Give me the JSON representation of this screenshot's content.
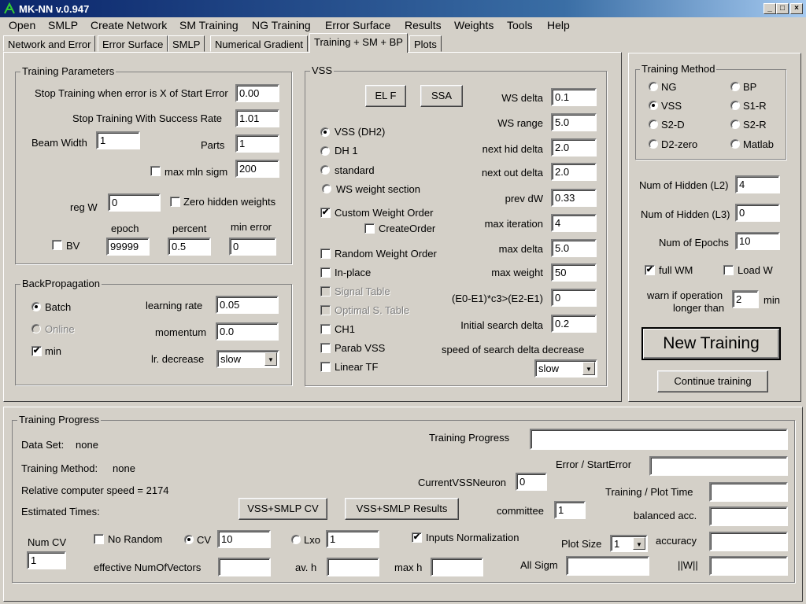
{
  "window": {
    "title": "MK-NN   v.0.947"
  },
  "menu": [
    "Open",
    "SMLP",
    "Create Network",
    "SM Training",
    "NG Training",
    "Error Surface",
    "Results",
    "Weights",
    "Tools",
    "Help"
  ],
  "tabs": [
    "Network and Error",
    "Error Surface",
    "SMLP",
    "Numerical Gradient",
    "Training + SM + BP",
    "Plots"
  ],
  "training_params": {
    "title": "Training Parameters",
    "stop_error_label": "Stop Training when error is X of Start Error",
    "stop_error_value": "0.00",
    "stop_success_label": "Stop Training With Success Rate",
    "stop_success_value": "1.01",
    "beam_width_label": "Beam Width",
    "beam_width_value": "1",
    "parts_label": "Parts",
    "parts_value": "1",
    "max_mln_label": "max mln sigm",
    "max_mln_value": "200",
    "reg_w_label": "reg W",
    "reg_w_value": "0",
    "zero_hidden_label": "Zero hidden weights",
    "epoch_label": "epoch",
    "percent_label": "percent",
    "min_error_label": "min error",
    "bv_label": "BV",
    "epoch_value": "99999",
    "percent_value": "0.5",
    "min_error_value": "0"
  },
  "backprop": {
    "title": "BackPropagation",
    "batch_label": "Batch",
    "online_label": "Online",
    "min_label": "min",
    "learning_rate_label": "learning rate",
    "learning_rate_value": "0.05",
    "momentum_label": "momentum",
    "momentum_value": "0.0",
    "lr_decrease_label": "lr. decrease",
    "lr_decrease_value": "slow"
  },
  "vss": {
    "title": "VSS",
    "elf_button": "EL F",
    "ssa_button": "SSA",
    "radio_vss_dh2": "VSS (DH2)",
    "radio_dh1": "DH 1",
    "radio_standard": "standard",
    "radio_ws_section": "WS weight section",
    "custom_weight_order": "Custom Weight Order",
    "create_order": "CreateOrder",
    "random_weight_order": "Random Weight Order",
    "in_place": "In-place",
    "signal_table": "Signal Table",
    "optimal_s_table": "Optimal S. Table",
    "ch1": "CH1",
    "parab_vss": "Parab VSS",
    "linear_tf": "Linear TF",
    "fields": [
      {
        "label": "WS delta",
        "value": "0.1"
      },
      {
        "label": "WS range",
        "value": "5.0"
      },
      {
        "label": "next hid delta",
        "value": "2.0"
      },
      {
        "label": "next out delta",
        "value": "2.0"
      },
      {
        "label": "prev dW",
        "value": "0.33"
      },
      {
        "label": "max iteration",
        "value": "4"
      },
      {
        "label": "max delta",
        "value": "5.0"
      },
      {
        "label": "max weight",
        "value": "50"
      },
      {
        "label": "(E0-E1)*c3>(E2-E1)",
        "value": "0"
      },
      {
        "label": "Initial search delta",
        "value": "0.2"
      }
    ],
    "speed_label": "speed of search delta decrease",
    "speed_value": "slow"
  },
  "training_method": {
    "title": "Training Method",
    "options": [
      "NG",
      "BP",
      "VSS",
      "S1-R",
      "S2-D",
      "S2-R",
      "D2-zero",
      "Matlab"
    ],
    "selected": "VSS"
  },
  "right_panel": {
    "hidden_l2_label": "Num of Hidden (L2)",
    "hidden_l2_value": "4",
    "hidden_l3_label": "Num of Hidden (L3)",
    "hidden_l3_value": "0",
    "epochs_label": "Num of Epochs",
    "epochs_value": "10",
    "full_wm_label": "full WM",
    "load_w_label": "Load W",
    "warn_label_1": "warn if operation",
    "warn_label_2": "longer than",
    "warn_value": "2",
    "warn_unit": "min",
    "new_training_button": "New Training",
    "continue_button": "Continue training"
  },
  "progress": {
    "title": "Training Progress",
    "data_set_label": "Data Set:",
    "data_set_value": "none",
    "method_label": "Training Method:",
    "method_value": "none",
    "speed_text": "Relative computer speed = 2174",
    "estimated_label": "Estimated Times:",
    "vss_cv_button": "VSS+SMLP CV",
    "vss_results_button": "VSS+SMLP Results",
    "training_progress_label": "Training Progress",
    "error_start_label": "Error / StartError",
    "current_vss_label": "CurrentVSSNeuron",
    "current_vss_value": "0",
    "plot_time_label": "Training / Plot Time",
    "committee_label": "committee",
    "committee_value": "1",
    "balanced_label": "balanced acc.",
    "num_cv_label": "Num CV",
    "num_cv_value": "1",
    "no_random_label": "No Random",
    "cv_label": "CV",
    "cv_value": "10",
    "lxo_label": "Lxo",
    "lxo_value": "1",
    "inputs_norm_label": "Inputs Normalization",
    "plot_size_label": "Plot Size",
    "plot_size_value": "1",
    "accuracy_label": "accuracy",
    "eff_num_label": "effective NumOfVectors",
    "av_h_label": "av. h",
    "max_h_label": "max h",
    "all_sigm_label": "All Sigm",
    "norm_w_label": "||W||"
  }
}
